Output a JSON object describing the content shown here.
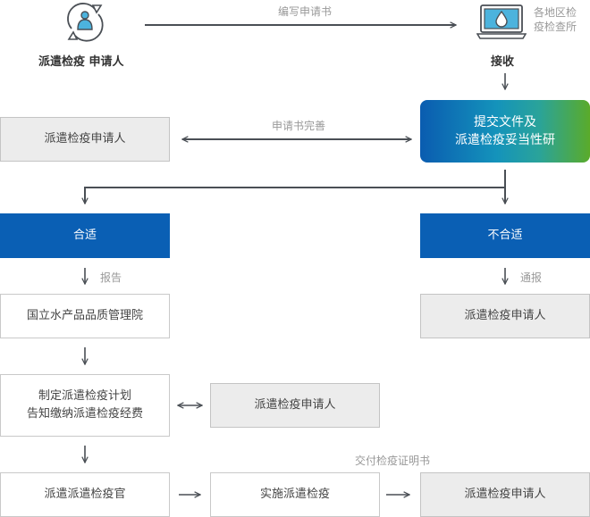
{
  "colors": {
    "blue": "#0a5fb4",
    "gradient_start": "#0a5cb0",
    "gradient_end": "#5aab2a",
    "gray_box": "#ececec",
    "line": "#4a4f55",
    "label": "#999999",
    "icon_fill": "#4cb3dd"
  },
  "top": {
    "applicant_icon": "person-cycle-icon",
    "applicant_label": "派遣检疫 申请人",
    "arrow_label": "编写申请书",
    "office_icon": "laptop-water-drop-icon",
    "office_label": "各地区检\n疫检查所",
    "office_label_line1": "各地区检",
    "office_label_line2": "疫检查所",
    "receive_label": "接收"
  },
  "review": {
    "applicant_box": "派遣检疫申请人",
    "arrow_label": "申请书完善",
    "review_box_line1": "提交文件及",
    "review_box_line2": "派遣检疫妥当性研"
  },
  "decision": {
    "suitable": "合适",
    "unsuitable": "不合适",
    "report_label": "报告",
    "notify_label": "通报"
  },
  "left_flow": {
    "institute": "国立水产品品质管理院",
    "plan_line1": "制定派遣检疫计划",
    "plan_line2": "告知缴纳派遣检疫经费",
    "plan_applicant": "派遣检疫申请人",
    "officer": "派遣派遣检疫官",
    "execute": "实施派遣检疫",
    "certificate_label": "交付检疫证明书",
    "final_applicant": "派遣检疫申请人"
  },
  "right_flow": {
    "notified_applicant": "派遣检疫申请人"
  }
}
